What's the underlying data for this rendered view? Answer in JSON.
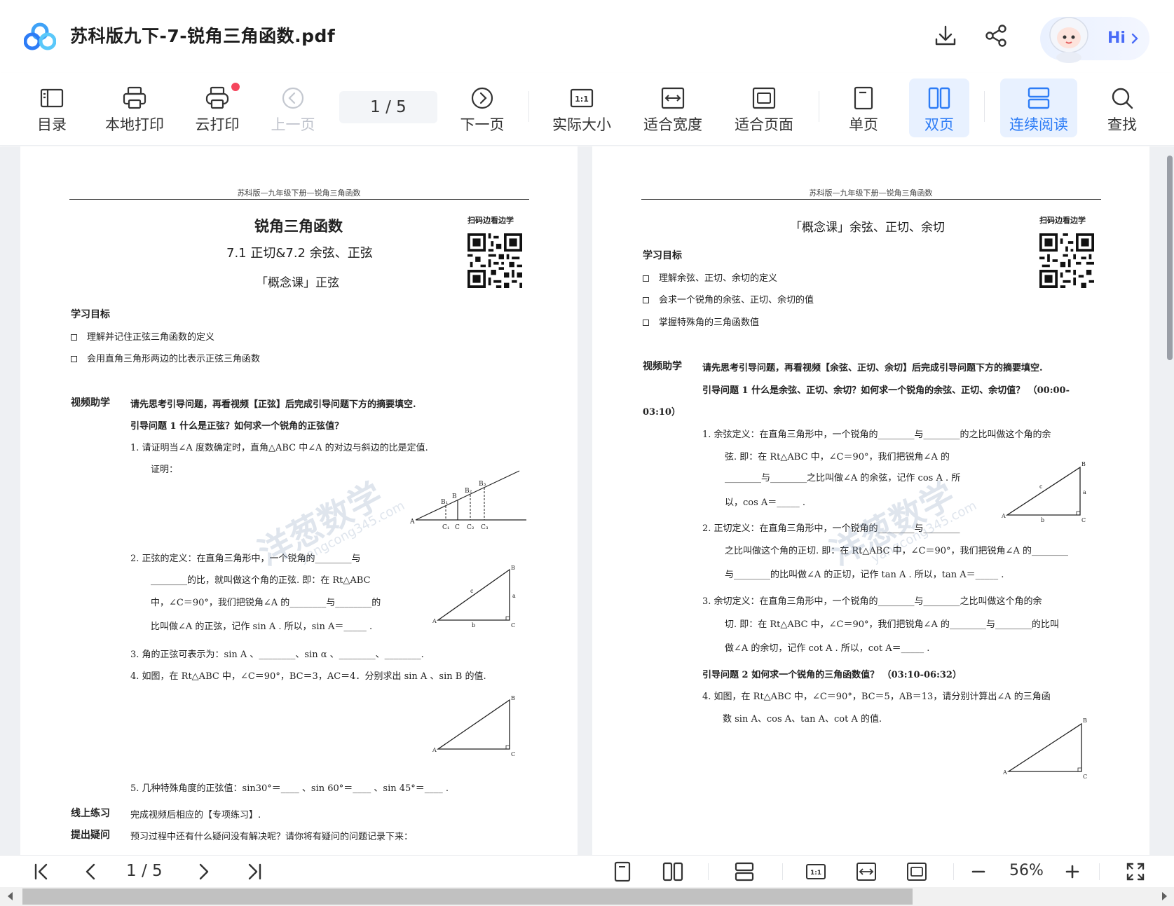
{
  "titlebar": {
    "doc_title": "苏科版九下-7-锐角三角函数.pdf",
    "hi_label": "Hi"
  },
  "toolbar": {
    "toc": "目录",
    "local_print": "本地打印",
    "cloud_print": "云打印",
    "prev_page": "上一页",
    "page_indicator": "1  / 5",
    "next_page": "下一页",
    "actual_size": "实际大小",
    "fit_width": "适合宽度",
    "fit_page": "适合页面",
    "single_page": "单页",
    "double_page": "双页",
    "continuous": "连续阅读",
    "find": "查找",
    "actual_size_icon_text": "1:1"
  },
  "page_left": {
    "running_head": "苏科版—九年级下册—锐角三角函数",
    "qr_label": "扫码边看边学",
    "title": "锐角三角函数",
    "subtitle": "7.1 正切&7.2 余弦、正弦",
    "lesson": "「概念课」正弦",
    "goals_heading": "学习目标",
    "goals": [
      "理解并记住正弦三角函数的定义",
      "会用直角三角形两边的比表示正弦三角函数"
    ],
    "video_heading": "视频助学",
    "video_intro": "请先思考引导问题，再看视频【正弦】后完成引导问题下方的摘要填空.",
    "guide_q1": "引导问题 1    什么是正弦？如何求一个锐角的正弦值？",
    "item1": "1.    请证明当∠A 度数确定时，直角△ABC 中∠A 的对边与斜边的比是定值.",
    "item1_proof": "证明：",
    "item2_a": "2.    正弦的定义：在直角三角形中，一个锐角的________与",
    "item2_b": "________的比，就叫做这个角的正弦. 即：在 Rt△ABC",
    "item2_c": "中，∠C＝90°，我们把锐角∠A 的________与________的",
    "item2_d": "比叫做∠A 的正弦，记作 sin A . 所以，sin A＝_____ .",
    "item3": "3.    角的正弦可表示为：sin A 、________、sin α 、________、________.",
    "item4": "4.    如图，在 Rt△ABC 中，∠C＝90°，BC＝3，AC＝4．分别求出 sin A 、sin B 的值.",
    "item5": "5.    几种特殊角度的正弦值：sin30°＝____ 、sin 60°＝____ 、sin 45°＝____ .",
    "online_heading": "线上练习",
    "online_text": "完成视频后相应的【专项练习】.",
    "ask_heading": "提出疑问",
    "ask_text": "预习过程中还有什么疑问没有解决呢？请你将有疑问的问题记录下来：",
    "watermark": "洋葱数学",
    "watermark_url": "yangcong345.com"
  },
  "page_right": {
    "running_head": "苏科版—九年级下册—锐角三角函数",
    "qr_label": "扫码边看边学",
    "lesson": "「概念课」余弦、正切、余切",
    "goals_heading": "学习目标",
    "goals": [
      "理解余弦、正切、余切的定义",
      "会求一个锐角的余弦、正切、余切的值",
      "掌握特殊角的三角函数值"
    ],
    "video_heading": "视频助学",
    "video_intro": "请先思考引导问题，再看视频【余弦、正切、余切】后完成引导问题下方的摘要填空.",
    "guide_q1": "引导问题 1    什么是余弦、正切、余切？如何求一个锐角的余弦、正切、余切值？  （00:00-",
    "guide_q1_time": "03:10）",
    "item1_a": "1.    余弦定义：在直角三角形中，一个锐角的________与________的之比叫做这个角的余",
    "item1_b": "弦. 即：在 Rt△ABC 中，∠C＝90°，我们把锐角∠A 的",
    "item1_c": "________与________之比叫做∠A 的余弦，记作 cos A . 所",
    "item1_d": "以，cos A＝_____ .",
    "item2_a": "2.    正切定义：在直角三角形中，一个锐角的________与________",
    "item2_b": "之比叫做这个角的正切. 即：在 Rt△ABC 中，∠C＝90°，我们把锐角∠A 的________",
    "item2_c": "与________的比叫做∠A 的正切，记作 tan A . 所以，tan A＝_____ .",
    "item3_a": "3.    余切定义：在直角三角形中，一个锐角的________与________之比叫做这个角的余",
    "item3_b": "切. 即：在 Rt△ABC 中，∠C＝90°，我们把锐角∠A 的________与________的比叫",
    "item3_c": "做∠A 的余切，记作 cot A . 所以，cot A＝_____ .",
    "guide_q2": "引导问题 2    如何求一个锐角的三角函数值？  （03:10-06:32）",
    "item4_a": "4.    如图，在 Rt△ABC 中，∠C＝90°，BC＝5，AB＝13，请分别计算出∠A 的三角函",
    "item4_b": "数 sin A、cos A、tan A、cot A 的值.",
    "watermark": "洋葱数学",
    "watermark_url": "yangcong345.com"
  },
  "bottombar": {
    "page_indicator": "1 / 5",
    "zoom": "56%"
  },
  "figure_labels": {
    "A": "A",
    "B": "B",
    "C": "C",
    "a": "a",
    "b": "b",
    "c": "c",
    "B1": "B₁",
    "B2": "B₂",
    "B3": "B₃",
    "C1": "C₁",
    "C2": "C₂",
    "C3": "C₃"
  },
  "colors": {
    "accent": "#2d7cf6",
    "active_bg": "#e8f1ff",
    "notification": "#f5455c"
  }
}
